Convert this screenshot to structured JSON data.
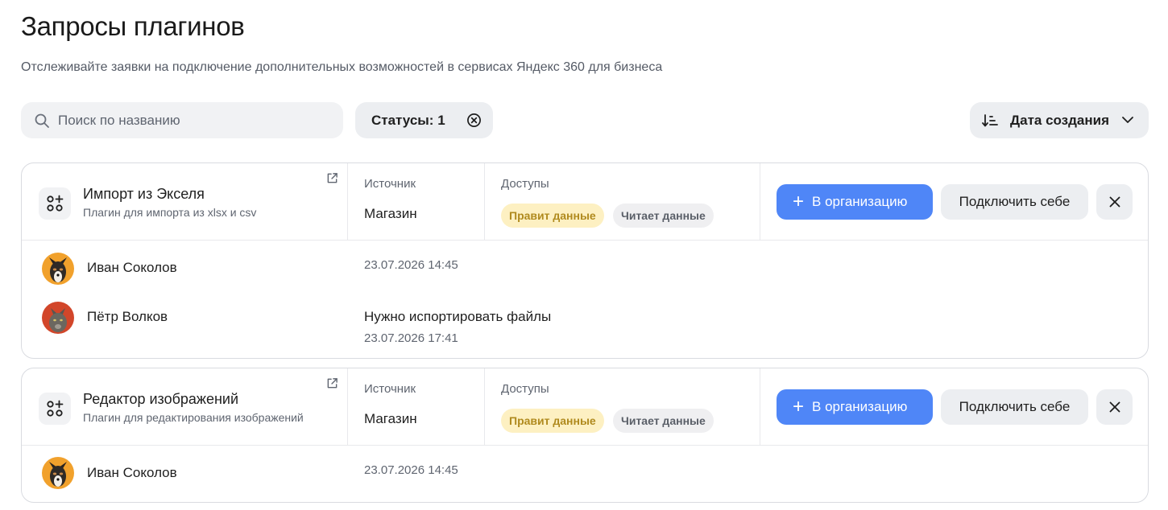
{
  "page": {
    "title": "Запросы плагинов",
    "subtitle": "Отслеживайте заявки на подключение дополнительных возможностей в сервисах Яндекс 360 для бизнеса"
  },
  "toolbar": {
    "search_placeholder": "Поиск по названию",
    "search_value": "",
    "status_filter_label": "Статусы: 1",
    "sort_label": "Дата создания"
  },
  "columns": {
    "source": "Источник",
    "permissions": "Доступы"
  },
  "actions": {
    "add_to_org": "В организацию",
    "connect_self": "Подключить себе"
  },
  "colors": {
    "primary": "#4f86f7",
    "edit_badge_bg": "#fdf0c2",
    "edit_badge_text": "#b08a1e",
    "read_badge_bg": "#efeff1"
  },
  "cards": [
    {
      "name": "Импорт из Экселя",
      "description": "Плагин для импорта из xlsx и csv",
      "source": "Магазин",
      "permissions": [
        "Правит данные",
        "Читает данные"
      ],
      "requests": [
        {
          "user": "Иван Соколов",
          "comment": "",
          "date": "23.07.2026 14:45",
          "avatar": "dog-avatar"
        },
        {
          "user": "Пётр Волков",
          "comment": "Нужно испортировать файлы",
          "date": "23.07.2026 17:41",
          "avatar": "cat-avatar"
        }
      ]
    },
    {
      "name": "Редактор изображений",
      "description": "Плагин для редактирования изображений",
      "source": "Магазин",
      "permissions": [
        "Правит данные",
        "Читает данные"
      ],
      "requests": [
        {
          "user": "Иван Соколов",
          "comment": "",
          "date": "23.07.2026 14:45",
          "avatar": "dog-avatar"
        }
      ]
    }
  ]
}
